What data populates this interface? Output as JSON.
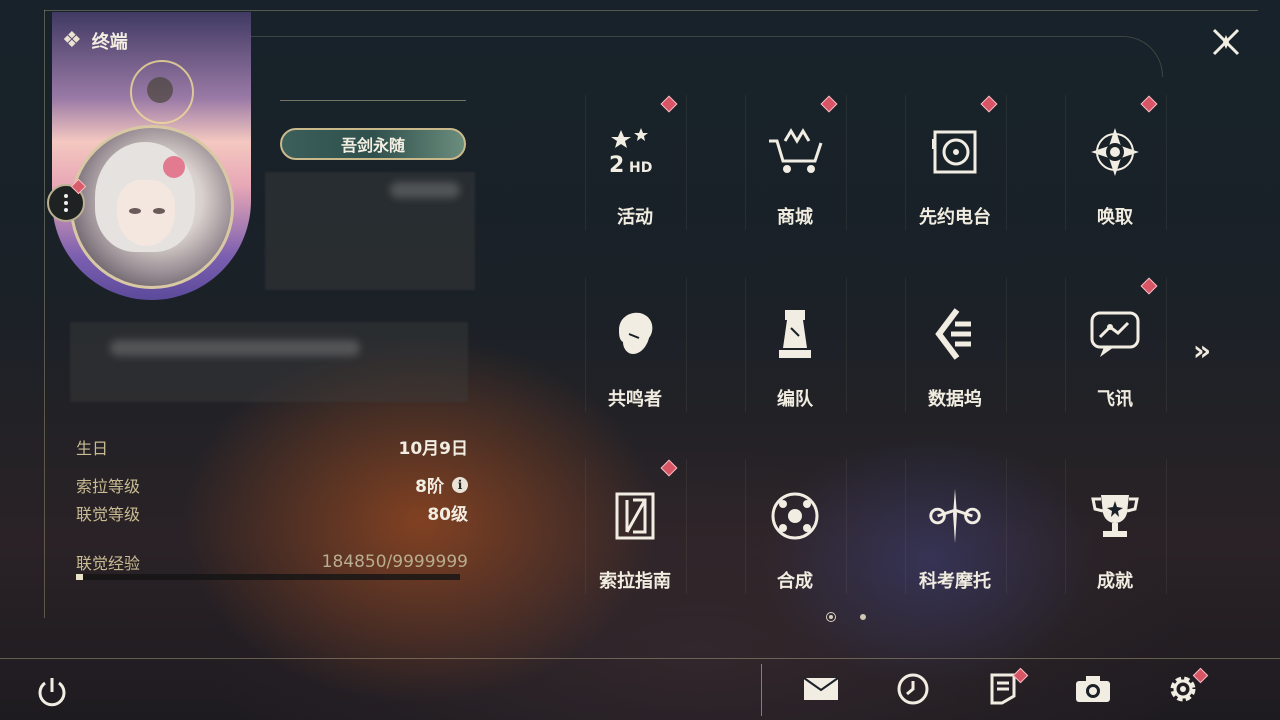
{
  "header": {
    "title": "终端",
    "title_icon": "diamond-grid-icon",
    "close_icon": "close-x-icon"
  },
  "profile": {
    "badge": "吾剑永随",
    "birthday_label": "生日",
    "birthday_value": "10月9日",
    "sola_level_label": "索拉等级",
    "sola_level_value": "8阶",
    "union_level_label": "联觉等级",
    "union_level_value": "80级",
    "union_exp_label": "联觉经验",
    "union_exp_value": "184850/9999999",
    "union_exp_progress": 0.018
  },
  "menu": [
    {
      "id": "activity",
      "label": "活动",
      "icon": "activity-2hd-icon",
      "alert": true
    },
    {
      "id": "shop",
      "label": "商城",
      "icon": "shop-cart-icon",
      "alert": true
    },
    {
      "id": "radio",
      "label": "先约电台",
      "icon": "radio-icon",
      "alert": true
    },
    {
      "id": "convene",
      "label": "唤取",
      "icon": "compass-star-icon",
      "alert": true
    },
    {
      "id": "resonators",
      "label": "共鸣者",
      "icon": "character-head-icon",
      "alert": false
    },
    {
      "id": "team",
      "label": "编队",
      "icon": "chess-piece-icon",
      "alert": false
    },
    {
      "id": "databank",
      "label": "数据坞",
      "icon": "data-bank-icon",
      "alert": false
    },
    {
      "id": "messenger",
      "label": "飞讯",
      "icon": "chat-bubble-icon",
      "alert": true
    },
    {
      "id": "guide",
      "label": "索拉指南",
      "icon": "guide-book-icon",
      "alert": true
    },
    {
      "id": "synthesis",
      "label": "合成",
      "icon": "synthesis-icon",
      "alert": false
    },
    {
      "id": "kk",
      "label": "科考摩托",
      "icon": "motorbike-icon",
      "alert": false
    },
    {
      "id": "achievements",
      "label": "成就",
      "icon": "trophy-icon",
      "alert": false
    }
  ],
  "pagination": {
    "current": 1,
    "total": 2
  },
  "next_page_icon": "double-chevron-right-icon",
  "bottom_bar": {
    "power_icon": "power-icon",
    "items": [
      {
        "id": "mail",
        "icon": "mail-icon",
        "alert": false
      },
      {
        "id": "clock",
        "icon": "clock-icon",
        "alert": false
      },
      {
        "id": "notice",
        "icon": "notice-icon",
        "alert": true
      },
      {
        "id": "camera",
        "icon": "camera-icon",
        "alert": false
      },
      {
        "id": "settings",
        "icon": "gear-icon",
        "alert": true
      }
    ]
  },
  "colors": {
    "accent": "#c9bb92",
    "alert": "#d85565",
    "text": "#f1ece0"
  }
}
